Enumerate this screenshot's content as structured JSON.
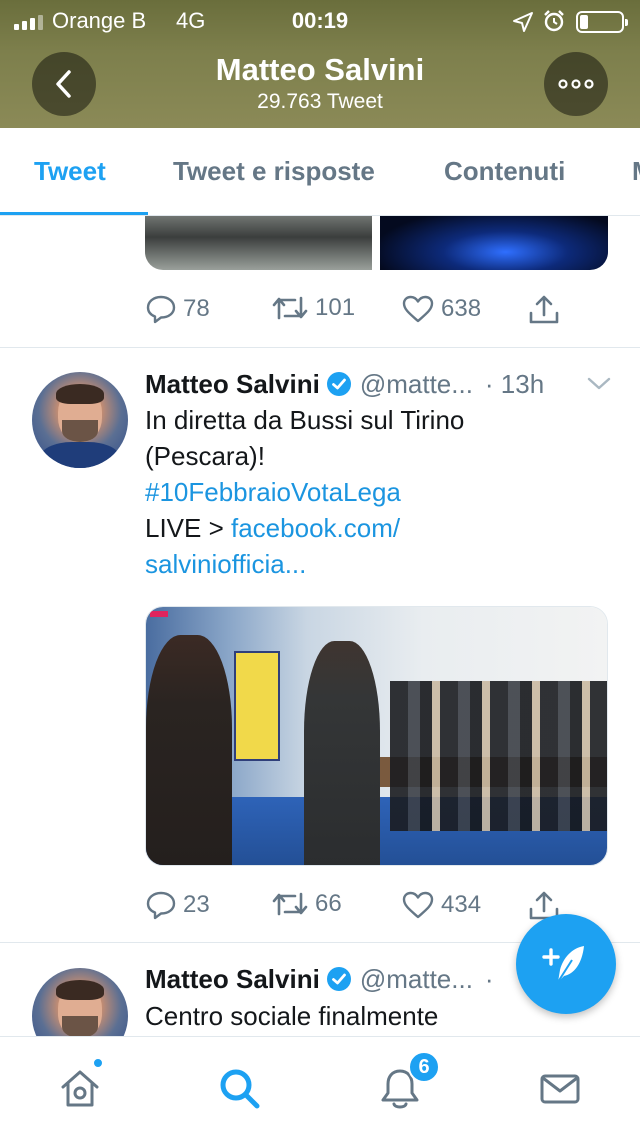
{
  "status_bar": {
    "carrier": "Orange B",
    "network": "4G",
    "time": "00:19",
    "battery_level": 0.2
  },
  "header": {
    "title": "Matteo Salvini",
    "subtitle": "29.763 Tweet"
  },
  "tabs": [
    {
      "label": "Tweet",
      "active": true
    },
    {
      "label": "Tweet e risposte",
      "active": false
    },
    {
      "label": "Contenuti",
      "active": false
    },
    {
      "label": "M",
      "active": false
    }
  ],
  "previous_tweet": {
    "replies": "78",
    "retweets": "101",
    "likes": "638"
  },
  "tweets": [
    {
      "name": "Matteo Salvini",
      "handle": "@matte...",
      "time": "· 13h",
      "text_line1": "In diretta da Bussi sul Tirino",
      "text_line2": "(Pescara)!",
      "hashtag": "#10FebbraioVotaLega",
      "live_prefix": "LIVE > ",
      "link_part1": "facebook.com/",
      "link_part2": "salviniofficia...",
      "replies": "23",
      "retweets": "66",
      "likes": "434"
    },
    {
      "name": "Matteo Salvini",
      "handle": "@matte...",
      "time": "·",
      "text_line1": "Centro sociale finalmente"
    }
  ],
  "bottom_nav": {
    "notifications_badge": "6"
  },
  "colors": {
    "accent": "#1da1f2",
    "link": "#1b95e0",
    "muted": "#657786"
  }
}
